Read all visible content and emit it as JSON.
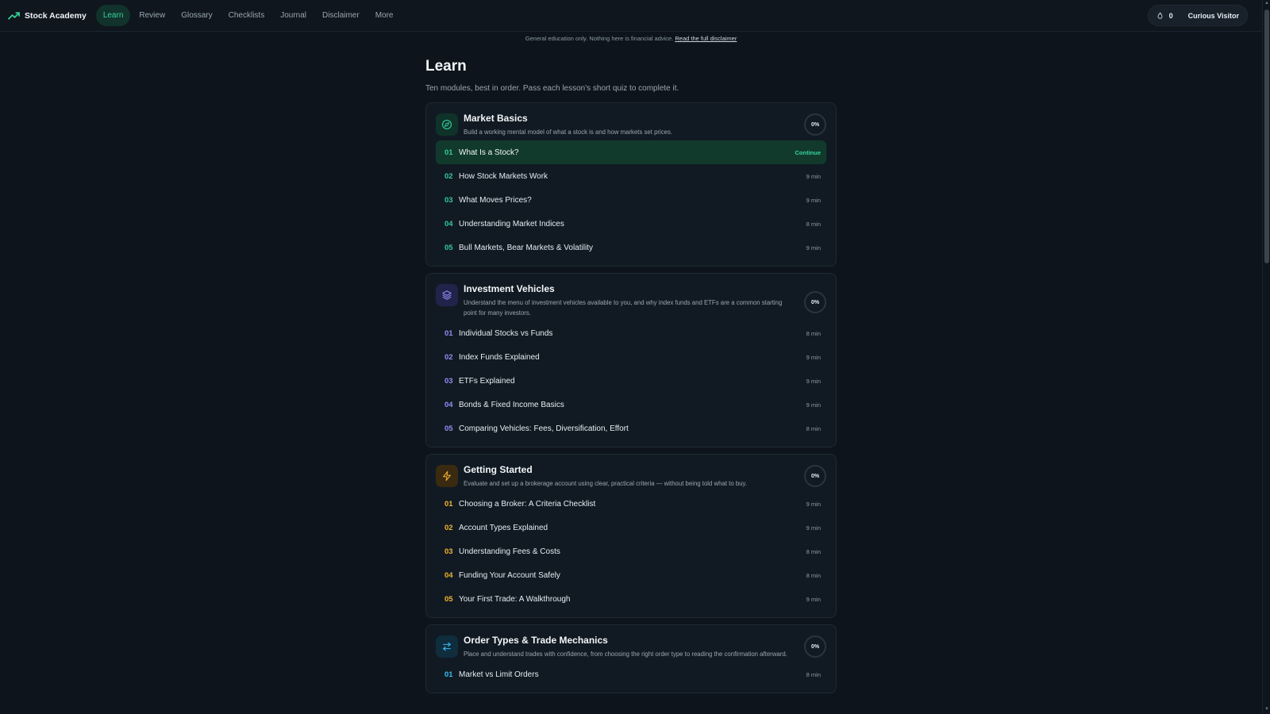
{
  "brand": {
    "name": "Stock Academy"
  },
  "nav": {
    "items": [
      {
        "label": "Learn",
        "active": true
      },
      {
        "label": "Review"
      },
      {
        "label": "Glossary"
      },
      {
        "label": "Checklists"
      },
      {
        "label": "Journal"
      },
      {
        "label": "Disclaimer"
      },
      {
        "label": "More"
      }
    ]
  },
  "user": {
    "streak": "0",
    "name": "Curious Visitor",
    "streak_icon": "flame-icon"
  },
  "disclaimer": {
    "text": "General education only. Nothing here is financial advice.",
    "link": "Read the full disclaimer"
  },
  "page": {
    "title": "Learn",
    "subtitle": "Ten modules, best in order. Pass each lesson's short quiz to complete it."
  },
  "colors": {
    "accent": "#37d39a",
    "market_basics": "#34c99a",
    "investment_vehicles": "#8f8ff5",
    "getting_started": "#f0b233",
    "order_types": "#38bdf8"
  },
  "modules": [
    {
      "title": "Market Basics",
      "description": "Build a working mental model of what a stock is and how markets set prices.",
      "progress": "0%",
      "icon": "compass-icon",
      "lessons": [
        {
          "num": "01",
          "title": "What Is a Stock?",
          "meta": "Continue"
        },
        {
          "num": "02",
          "title": "How Stock Markets Work",
          "meta": "9 min"
        },
        {
          "num": "03",
          "title": "What Moves Prices?",
          "meta": "9 min"
        },
        {
          "num": "04",
          "title": "Understanding Market Indices",
          "meta": "8 min"
        },
        {
          "num": "05",
          "title": "Bull Markets, Bear Markets & Volatility",
          "meta": "9 min"
        }
      ]
    },
    {
      "title": "Investment Vehicles",
      "description": "Understand the menu of investment vehicles available to you, and why index funds and ETFs are a common starting point for many investors.",
      "progress": "0%",
      "icon": "layers-icon",
      "lessons": [
        {
          "num": "01",
          "title": "Individual Stocks vs Funds",
          "meta": "8 min"
        },
        {
          "num": "02",
          "title": "Index Funds Explained",
          "meta": "9 min"
        },
        {
          "num": "03",
          "title": "ETFs Explained",
          "meta": "9 min"
        },
        {
          "num": "04",
          "title": "Bonds & Fixed Income Basics",
          "meta": "9 min"
        },
        {
          "num": "05",
          "title": "Comparing Vehicles: Fees, Diversification, Effort",
          "meta": "8 min"
        }
      ]
    },
    {
      "title": "Getting Started",
      "description": "Evaluate and set up a brokerage account using clear, practical criteria — without being told what to buy.",
      "progress": "0%",
      "icon": "lightning-icon",
      "lessons": [
        {
          "num": "01",
          "title": "Choosing a Broker: A Criteria Checklist",
          "meta": "9 min"
        },
        {
          "num": "02",
          "title": "Account Types Explained",
          "meta": "9 min"
        },
        {
          "num": "03",
          "title": "Understanding Fees & Costs",
          "meta": "8 min"
        },
        {
          "num": "04",
          "title": "Funding Your Account Safely",
          "meta": "8 min"
        },
        {
          "num": "05",
          "title": "Your First Trade: A Walkthrough",
          "meta": "9 min"
        }
      ]
    },
    {
      "title": "Order Types & Trade Mechanics",
      "description": "Place and understand trades with confidence, from choosing the right order type to reading the confirmation afterward.",
      "progress": "0%",
      "icon": "swap-icon",
      "lessons": [
        {
          "num": "01",
          "title": "Market vs Limit Orders",
          "meta": "8 min"
        }
      ]
    }
  ]
}
